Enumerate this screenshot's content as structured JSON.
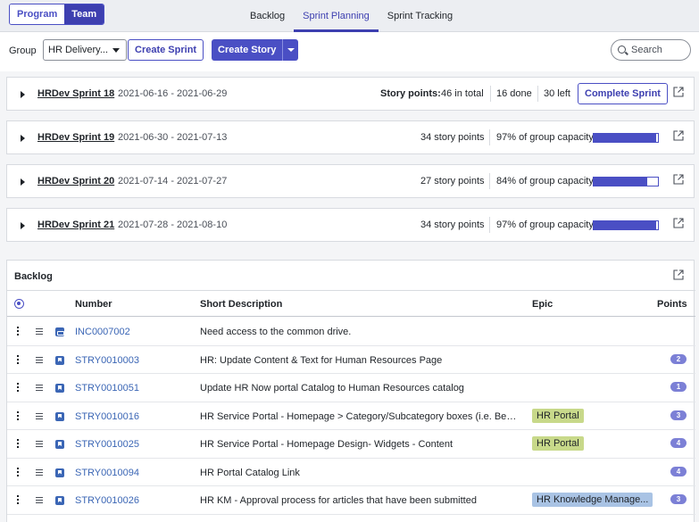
{
  "scope": {
    "program_label": "Program",
    "team_label": "Team",
    "active": "Team"
  },
  "tabs": [
    {
      "label": "Backlog",
      "active": false
    },
    {
      "label": "Sprint Planning",
      "active": true
    },
    {
      "label": "Sprint Tracking",
      "active": false
    }
  ],
  "toolbar": {
    "group_label": "Group",
    "group_value": "HR Delivery...",
    "create_sprint": "Create Sprint",
    "create_story": "Create Story",
    "search_placeholder": "Search"
  },
  "sprints": [
    {
      "name": "HRDev Sprint 18",
      "dates": "2021-06-16 - 2021-06-29",
      "sp_label": "Story points:",
      "total": "46 in total",
      "done": "16 done",
      "left": "30 left",
      "action": "Complete Sprint"
    },
    {
      "name": "HRDev Sprint 19",
      "dates": "2021-06-30 - 2021-07-13",
      "points": "34 story points",
      "capacity": "97% of group capacity",
      "capacity_value": 0.97
    },
    {
      "name": "HRDev Sprint 20",
      "dates": "2021-07-14 - 2021-07-27",
      "points": "27 story points",
      "capacity": "84% of group capacity",
      "capacity_value": 0.84
    },
    {
      "name": "HRDev Sprint 21",
      "dates": "2021-07-28 - 2021-08-10",
      "points": "34 story points",
      "capacity": "97% of group capacity",
      "capacity_value": 0.97
    }
  ],
  "backlog": {
    "title": "Backlog",
    "columns": {
      "number": "Number",
      "description": "Short Description",
      "epic": "Epic",
      "points": "Points"
    },
    "rows": [
      {
        "type": "incident",
        "number": "INC0007002",
        "description": "Need access to the common drive.",
        "epic": "",
        "points": ""
      },
      {
        "type": "story",
        "number": "STRY0010003",
        "description": "HR: Update Content & Text for Human Resources Page",
        "epic": "",
        "points": "2"
      },
      {
        "type": "story",
        "number": "STRY0010051",
        "description": "Update HR Now portal Catalog to Human Resources catalog",
        "epic": "",
        "points": "1"
      },
      {
        "type": "story",
        "number": "STRY0010016",
        "description": "HR Service Portal - Homepage > Category/Subcategory boxes (i.e. Benefits, C...",
        "epic": "HR Portal",
        "points": "3"
      },
      {
        "type": "story",
        "number": "STRY0010025",
        "description": "HR Service Portal - Homepage Design- Widgets - Content",
        "epic": "HR Portal",
        "points": "4"
      },
      {
        "type": "story",
        "number": "STRY0010094",
        "description": "HR Portal Catalog Link",
        "epic": "",
        "points": "4"
      },
      {
        "type": "story",
        "number": "STRY0010026",
        "description": "HR KM - Approval process for articles that have been submitted",
        "epic": "HR Knowledge Manage...",
        "points": "3"
      }
    ]
  },
  "colors": {
    "accent": "#4a4fc4",
    "link": "#3b66b5",
    "epic_hr_portal": "#c8d98a",
    "epic_hr_km": "#a9c3e4"
  }
}
